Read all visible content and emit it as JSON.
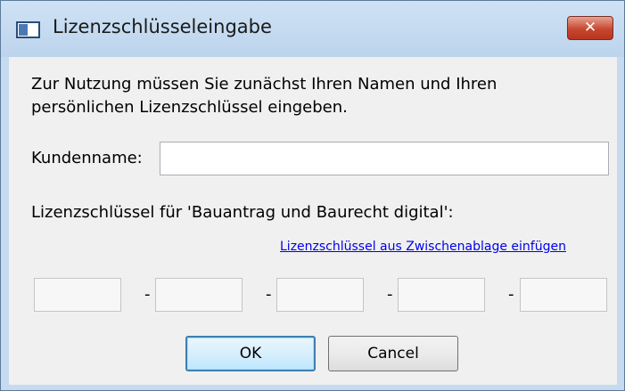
{
  "window": {
    "title": "Lizenzschlüsseleingabe",
    "close_label": "✕"
  },
  "intro_text": "Zur Nutzung müssen Sie zunächst Ihren Namen und Ihren persönlichen Lizenzschlüssel eingeben.",
  "customer": {
    "label": "Kundenname:",
    "value": ""
  },
  "license": {
    "label": "Lizenzschlüssel für 'Bauantrag und Baurecht digital':",
    "paste_link": "Lizenzschlüssel aus Zwischenablage einfügen",
    "segments": [
      "",
      "",
      "",
      "",
      ""
    ],
    "separator": "-"
  },
  "buttons": {
    "ok": "OK",
    "cancel": "Cancel"
  }
}
